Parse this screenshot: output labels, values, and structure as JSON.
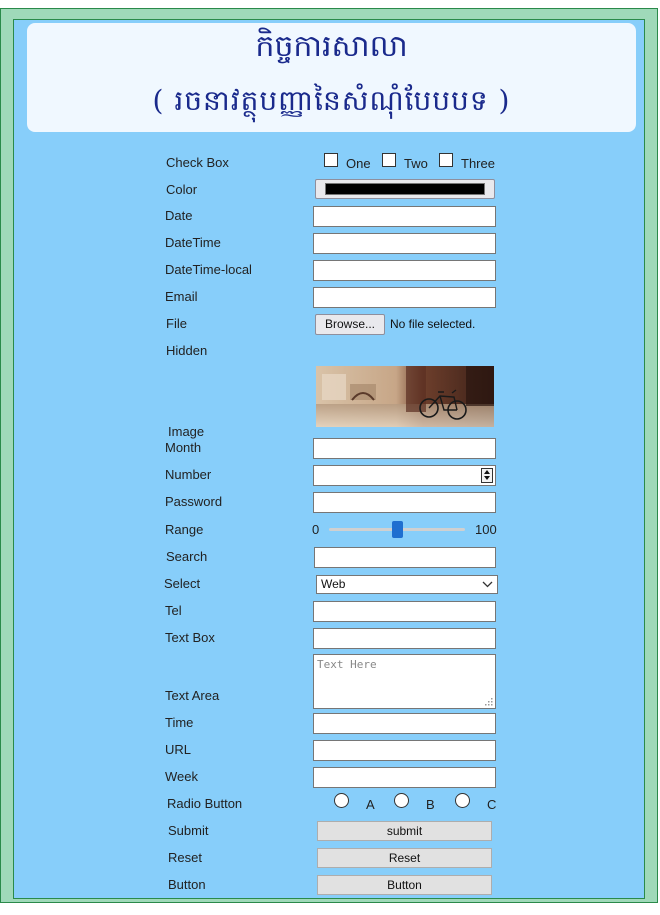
{
  "header": {
    "title": "កិច្ចការសាលា",
    "subtitle": "( រចនាវត្ថុបញ្ញានៃសំណុំបែបបទ )"
  },
  "form": {
    "checkbox": {
      "label": "Check Box",
      "options": [
        "One",
        "Two",
        "Three"
      ]
    },
    "color": {
      "label": "Color",
      "value": "#000000"
    },
    "date": {
      "label": "Date"
    },
    "datetime": {
      "label": "DateTime"
    },
    "datetime_local": {
      "label": "DateTime-local"
    },
    "email": {
      "label": "Email"
    },
    "file": {
      "label": "File",
      "button": "Browse...",
      "status": "No file selected."
    },
    "hidden": {
      "label": "Hidden"
    },
    "image": {
      "label": "Image"
    },
    "month": {
      "label": "Month"
    },
    "number": {
      "label": "Number"
    },
    "password": {
      "label": "Password"
    },
    "range": {
      "label": "Range",
      "min": "0",
      "max": "100",
      "value": 50
    },
    "search": {
      "label": "Search"
    },
    "select": {
      "label": "Select",
      "value": "Web"
    },
    "tel": {
      "label": "Tel"
    },
    "textbox": {
      "label": "Text Box"
    },
    "textarea": {
      "label": "Text Area",
      "placeholder": "Text Here"
    },
    "time": {
      "label": "Time"
    },
    "url": {
      "label": "URL"
    },
    "week": {
      "label": "Week"
    },
    "radio": {
      "label": "Radio Button",
      "options": [
        "A",
        "B",
        "C"
      ]
    },
    "submit": {
      "label": "Submit",
      "button": "submit"
    },
    "reset": {
      "label": "Reset",
      "button": "Reset"
    },
    "button": {
      "label": "Button",
      "button": "Button"
    }
  },
  "colors": {
    "background": "#87cefa",
    "frame": "#9fd9b9",
    "header_bg": "#f0f8ff",
    "title": "#1a2a8c",
    "accent": "#1f6fd0"
  }
}
